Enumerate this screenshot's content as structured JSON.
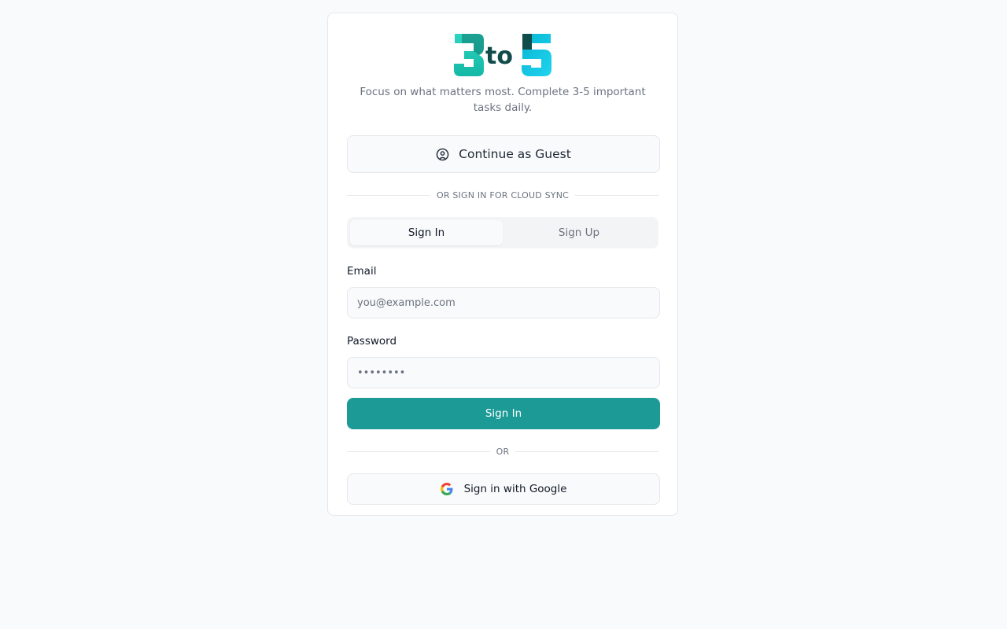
{
  "app": {
    "logo_text": "3to5",
    "tagline": "Focus on what matters most. Complete 3-5 important tasks daily."
  },
  "guest": {
    "label": "Continue as Guest",
    "icon": "user-circle-icon"
  },
  "cloud_divider": "OR SIGN IN FOR CLOUD SYNC",
  "tabs": [
    {
      "label": "Sign In",
      "active": true
    },
    {
      "label": "Sign Up",
      "active": false
    }
  ],
  "form": {
    "email_label": "Email",
    "email_placeholder": "you@example.com",
    "email_value": "",
    "password_label": "Password",
    "password_placeholder": "••••••••",
    "password_value": "",
    "submit_label": "Sign In"
  },
  "or_divider": "OR",
  "google": {
    "label": "Sign in with Google",
    "icon": "google-icon"
  },
  "colors": {
    "primary": "#1b9a96",
    "logo_teal_dark": "#0f4c4a",
    "logo_teal_light": "#2dd4bf",
    "page_bg": "#f9fafb"
  }
}
